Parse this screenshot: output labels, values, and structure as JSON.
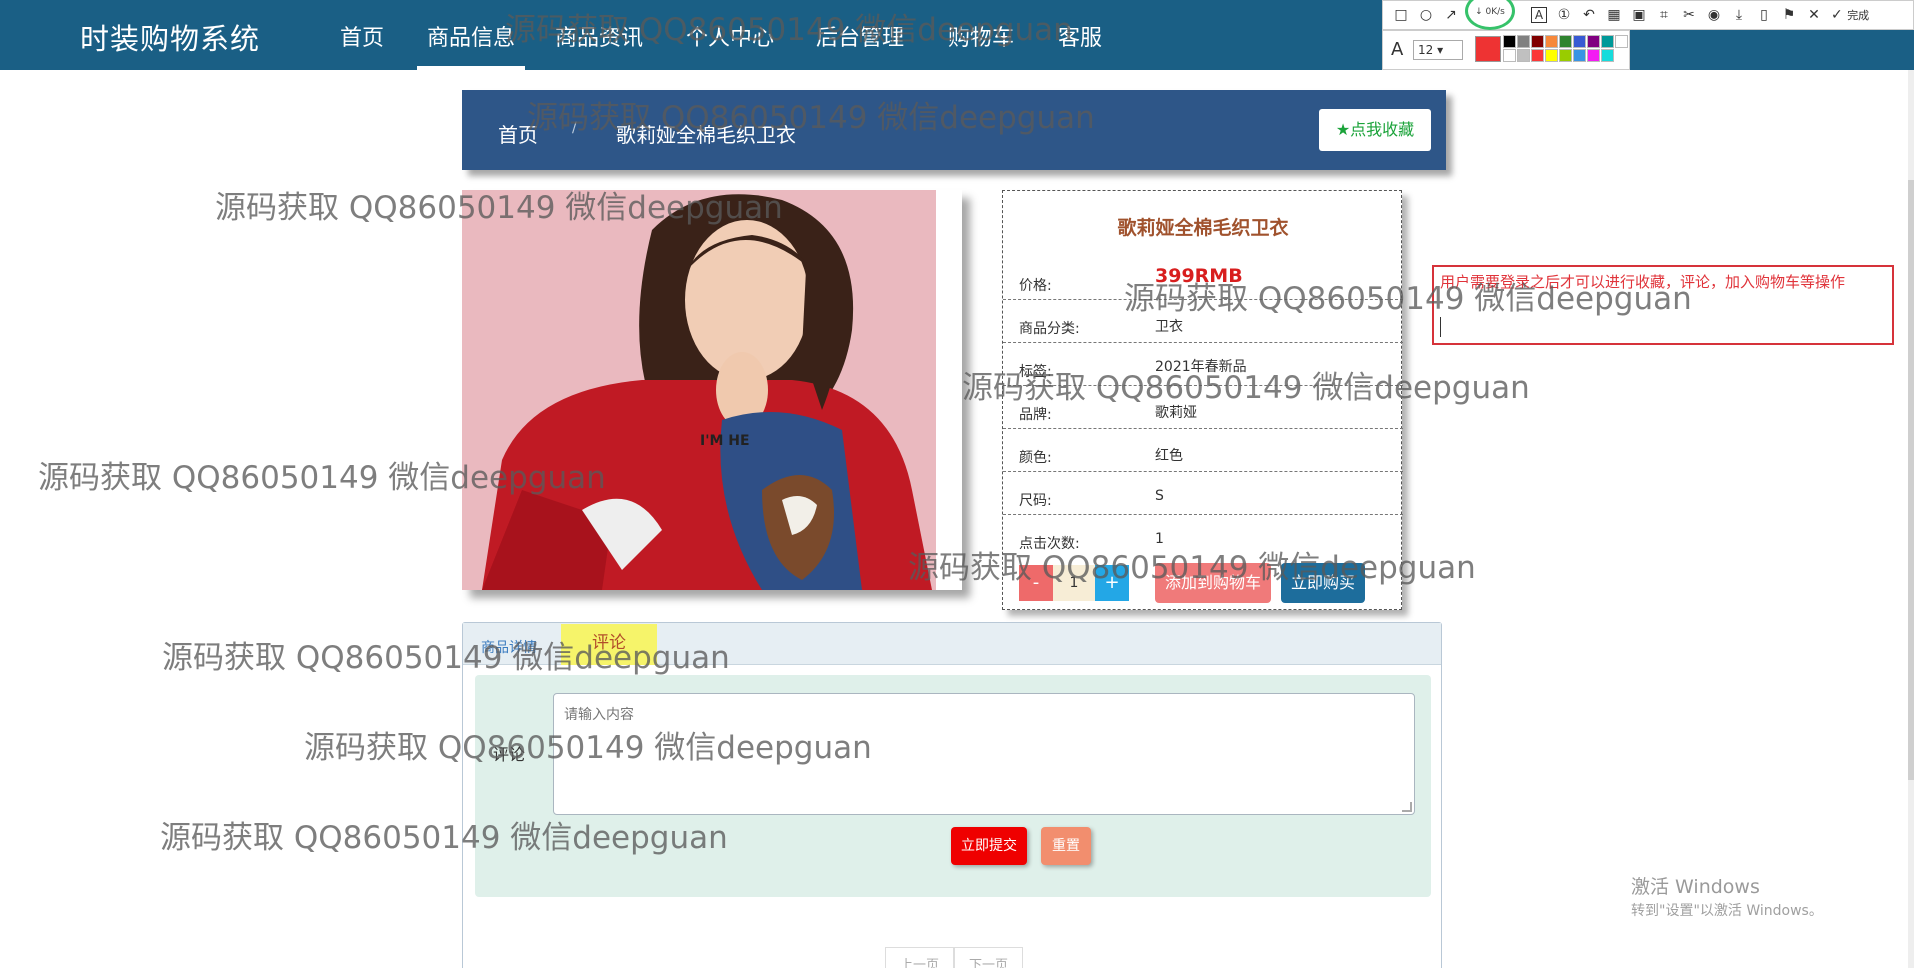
{
  "app": {
    "brand": "时装购物系统"
  },
  "nav": {
    "items": [
      "首页",
      "商品信息",
      "商品资讯",
      "个人中心",
      "后台管理",
      "购物车",
      "客服"
    ],
    "active_index": 1
  },
  "annotation_tool": {
    "net_speed": "0K/s",
    "font_size": "12",
    "done_label": "完成",
    "current_color": "#ee3333"
  },
  "breadcrumb": {
    "home": "首页",
    "separator": "/",
    "current": "歌莉娅全棉毛织卫衣",
    "favorite_button": "点我收藏"
  },
  "product": {
    "title": "歌莉娅全棉毛织卫衣",
    "fields": [
      {
        "label": "价格:",
        "value": "399RMB"
      },
      {
        "label": "商品分类:",
        "value": "卫衣"
      },
      {
        "label": "标签:",
        "value": "2021年春新品"
      },
      {
        "label": "品牌:",
        "value": "歌莉娅"
      },
      {
        "label": "颜色:",
        "value": "红色"
      },
      {
        "label": "尺码:",
        "value": "S"
      },
      {
        "label": "点击次数:",
        "value": "1"
      }
    ],
    "quantity": {
      "minus": "-",
      "value": "1",
      "plus": "+"
    },
    "add_to_cart_button": "添加到购物车",
    "buy_now_button": "立即购买"
  },
  "annotation_note": {
    "text": "用户需要登录之后才可以进行收藏，评论，加入购物车等操作"
  },
  "tabs": {
    "items": [
      "商品详情",
      "评论"
    ],
    "active_index": 1
  },
  "comment": {
    "label": "评论",
    "placeholder": "请输入内容",
    "submit_button": "立即提交",
    "reset_button": "重置"
  },
  "pager": {
    "prev": "上一页",
    "next": "下一页"
  },
  "windows_activation": {
    "title": "激活 Windows",
    "subtitle": "转到\"设置\"以激活 Windows。"
  },
  "watermark": {
    "text": "源码获取 QQ86050149 微信deepguan"
  }
}
